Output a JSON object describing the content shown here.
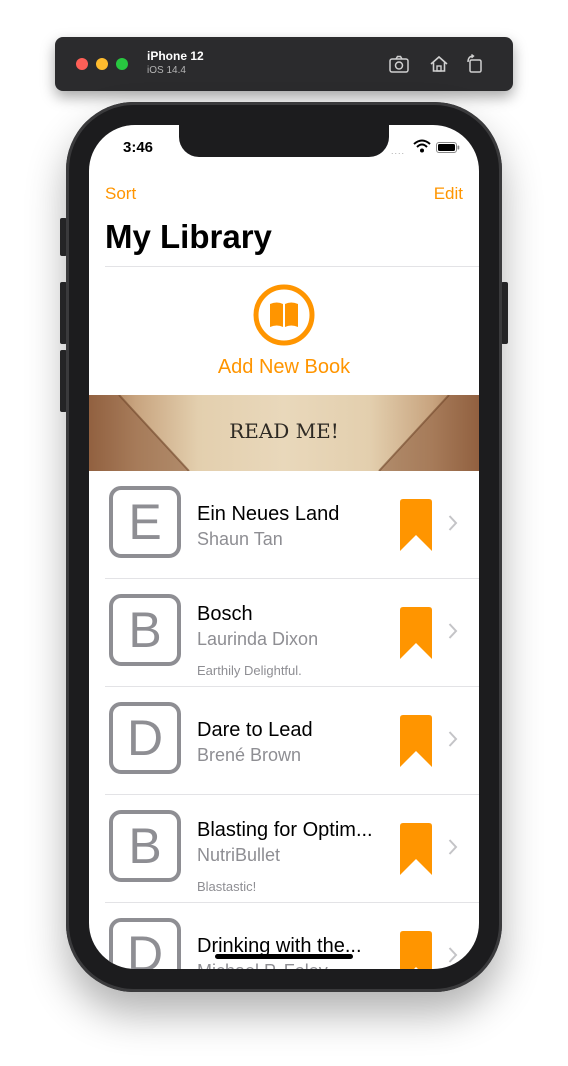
{
  "simulator": {
    "device": "iPhone 12",
    "os": "iOS 14.4",
    "icons": [
      "screenshot-icon",
      "home-icon",
      "rotate-icon"
    ]
  },
  "status_bar": {
    "time": "3:46",
    "signal": "....",
    "icons": [
      "wifi-icon",
      "battery-icon"
    ]
  },
  "nav": {
    "sort_label": "Sort",
    "edit_label": "Edit",
    "title": "My Library"
  },
  "add_book": {
    "label": "Add New Book",
    "icon": "book-icon"
  },
  "banner": {
    "label": "READ ME!"
  },
  "books": [
    {
      "initial": "E",
      "title": "Ein Neues Land",
      "author": "Shaun Tan",
      "note": ""
    },
    {
      "initial": "B",
      "title": "Bosch",
      "author": "Laurinda Dixon",
      "note": "Earthily Delightful."
    },
    {
      "initial": "D",
      "title": "Dare to Lead",
      "author": "Brené Brown",
      "note": ""
    },
    {
      "initial": "B",
      "title": "Blasting for Optim...",
      "author": "NutriBullet",
      "note": "Blastastic!"
    },
    {
      "initial": "D",
      "title": "Drinking with the...",
      "author": "Michael P. Foley",
      "note": ""
    }
  ],
  "colors": {
    "accent": "#ff9500",
    "secondary_text": "#8e8e93",
    "separator": "#e3e3e6"
  }
}
